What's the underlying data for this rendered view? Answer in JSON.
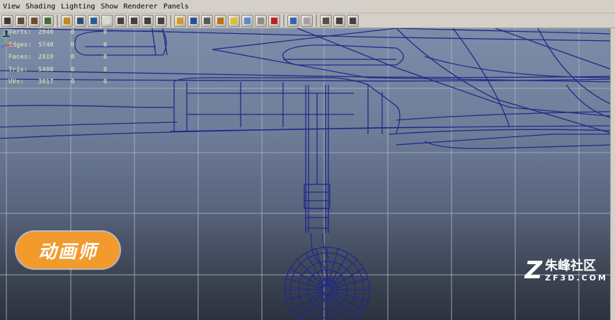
{
  "menu": [
    "View",
    "Shading",
    "Lighting",
    "Show",
    "Renderer",
    "Panels"
  ],
  "toolbar_icons": [
    {
      "name": "camera-attributes-icon",
      "color": "#3a3a3a"
    },
    {
      "name": "select-camera-icon",
      "color": "#5a4a3a"
    },
    {
      "name": "bookmark-icon",
      "color": "#6a4a2a"
    },
    {
      "name": "image-plane-icon",
      "color": "#3b6e3b"
    },
    {
      "name": "sep"
    },
    {
      "name": "2d-pan-zoom-icon",
      "color": "#c08a1a"
    },
    {
      "name": "grid-icon",
      "color": "#2a4a7a"
    },
    {
      "name": "film-gate-icon",
      "color": "#1f5aa0"
    },
    {
      "name": "resolution-gate-icon",
      "color": "#d8d8d8"
    },
    {
      "name": "gate-mask-icon",
      "color": "#404040"
    },
    {
      "name": "field-chart-icon",
      "color": "#404040"
    },
    {
      "name": "safe-action-icon",
      "color": "#404040"
    },
    {
      "name": "safe-title-icon",
      "color": "#404040"
    },
    {
      "name": "sep"
    },
    {
      "name": "wireframe-icon",
      "color": "#d89a20"
    },
    {
      "name": "smooth-shade-icon",
      "color": "#1e4fa0"
    },
    {
      "name": "flat-shade-icon",
      "color": "#5a5a5a"
    },
    {
      "name": "textured-icon",
      "color": "#c07010"
    },
    {
      "name": "use-all-lights-icon",
      "color": "#e0c020"
    },
    {
      "name": "shadows-icon",
      "color": "#5a8ad0"
    },
    {
      "name": "high-quality-icon",
      "color": "#8a8a8a"
    },
    {
      "name": "xray-icon",
      "color": "#c02020"
    },
    {
      "name": "sep"
    },
    {
      "name": "isolate-select-icon",
      "color": "#3060c0"
    },
    {
      "name": "xray-joints-icon",
      "color": "#a0a0a0"
    },
    {
      "name": "sep"
    },
    {
      "name": "xray-active-icon",
      "color": "#505050"
    },
    {
      "name": "wireframe-on-shaded-icon",
      "color": "#404040"
    },
    {
      "name": "backface-icon",
      "color": "#404040"
    }
  ],
  "hud": [
    {
      "label": "Verts:",
      "value": "2946",
      "a": "0",
      "b": "0"
    },
    {
      "label": "Edges:",
      "value": "5740",
      "a": "0",
      "b": "0"
    },
    {
      "label": "Faces:",
      "value": "2819",
      "a": "0",
      "b": "0"
    },
    {
      "label": "Tris:",
      "value": "5480",
      "a": "0",
      "b": "0"
    },
    {
      "label": "UVs:",
      "value": "3817",
      "a": "0",
      "b": "0"
    }
  ],
  "badge_text": "动画师",
  "watermark": {
    "cn": "朱峰社区",
    "en": "ZF3D.COM"
  },
  "colors": {
    "wire": "#1e2a8a",
    "grid": "#aab4c8",
    "hud": "#c8d0b0",
    "badge": "#f29a2b"
  }
}
